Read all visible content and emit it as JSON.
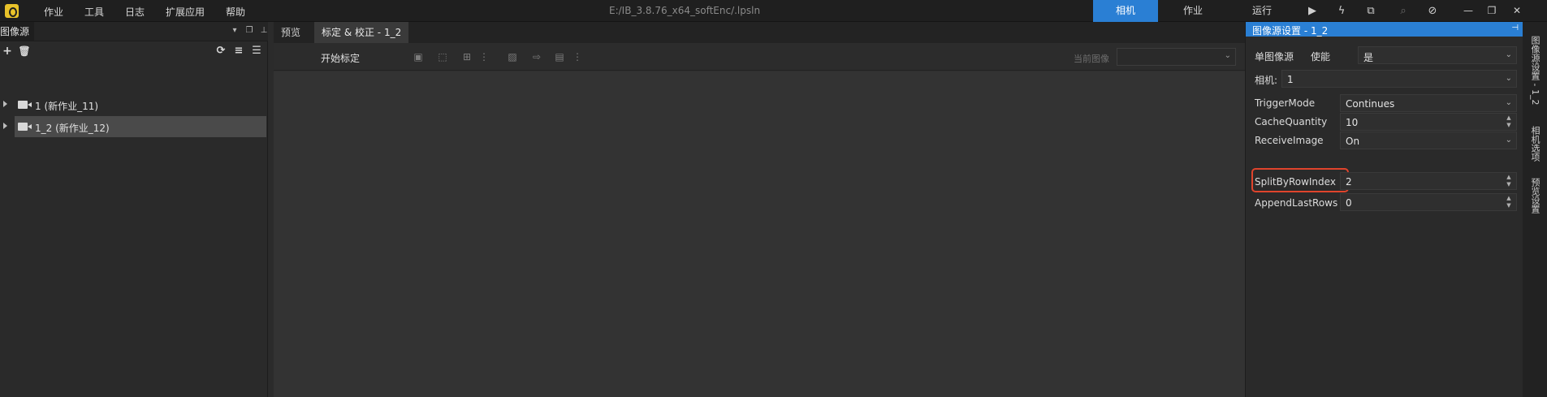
{
  "menu": {
    "items": [
      "作业",
      "工具",
      "日志",
      "扩展应用",
      "帮助"
    ],
    "title_path": "E:/IB_3.8.76_x64_softEnc/.lpsln",
    "modes": [
      "相机",
      "作业",
      "运行"
    ]
  },
  "left_panel": {
    "title": "图像源",
    "tree": [
      {
        "label": "1 (新作业_11)",
        "selected": false
      },
      {
        "label": "1_2 (新作业_12)",
        "selected": true
      }
    ]
  },
  "center": {
    "tabs": [
      "预览",
      "标定 & 校正  -  1_2"
    ],
    "toolbar": {
      "start_label": "开始标定",
      "current_image_label": "当前图像",
      "current_image_value": ""
    }
  },
  "right_panel": {
    "title": "图像源设置  -  1_2",
    "single_source": {
      "label": "单图像源",
      "enable_label": "使能",
      "value": "是"
    },
    "camera": {
      "label": "相机:",
      "value": "1"
    },
    "properties": [
      {
        "label": "TriggerMode",
        "value": "Continues",
        "kind": "select"
      },
      {
        "label": "CacheQuantity",
        "value": "10",
        "kind": "spin"
      },
      {
        "label": "ReceiveImage",
        "value": "On",
        "kind": "select"
      },
      {
        "label": "SplitByRowIndex",
        "value": "2",
        "kind": "spin"
      },
      {
        "label": "AppendLastRows",
        "value": "0",
        "kind": "spin"
      }
    ]
  },
  "vertical_tabs": [
    "图像源设置 - 1_2",
    "相机选项",
    "预览设置"
  ],
  "colors": {
    "accent": "#2a7fd4",
    "highlight": "#e0442c"
  }
}
